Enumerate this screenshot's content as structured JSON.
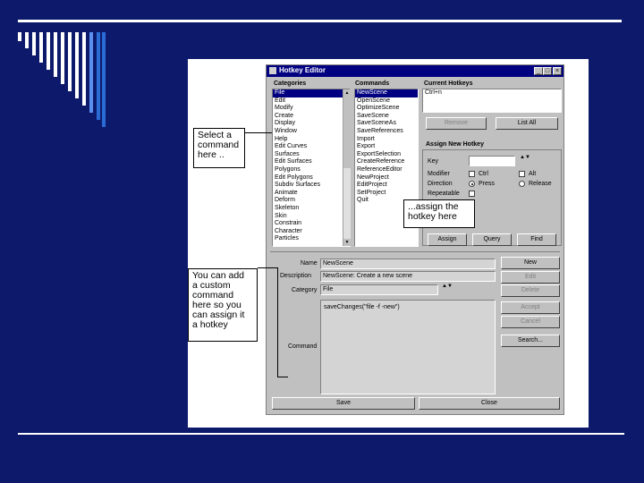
{
  "window": {
    "title": "Hotkey Editor",
    "controls": [
      "_",
      "□",
      "×"
    ]
  },
  "categories": {
    "header": "Categories",
    "items": [
      "File",
      "Edit",
      "Modify",
      "Create",
      "Display",
      "Window",
      "Help",
      "Edit Curves",
      "Surfaces",
      "Edit Surfaces",
      "Polygons",
      "Edit Polygons",
      "Subdiv Surfaces",
      "Animate",
      "Deform",
      "Skeleton",
      "Skin",
      "Constrain",
      "Character",
      "Particles"
    ]
  },
  "commands": {
    "header": "Commands",
    "items": [
      "NewScene",
      "OpenScene",
      "OptimizeScene",
      "SaveScene",
      "SaveSceneAs",
      "SaveReferences",
      "Import",
      "Export",
      "ExportSelection",
      "CreateReference",
      "ReferenceEditor",
      "NewProject",
      "EditProject",
      "SetProject",
      "Quit"
    ]
  },
  "current_hotkeys": {
    "header": "Current Hotkeys",
    "items": [
      "Ctrl+n"
    ],
    "remove_label": "Remove",
    "list_all_label": "List All"
  },
  "assign": {
    "header": "Assign New Hotkey",
    "key_label": "Key",
    "modifier_label": "Modifier",
    "ctrl_label": "Ctrl",
    "alt_label": "Alt",
    "direction_label": "Direction",
    "press_label": "Press",
    "release_label": "Release",
    "repeatable_label": "Repeatable",
    "assign_label": "Assign",
    "query_label": "Query",
    "find_label": "Find"
  },
  "editor": {
    "name_label": "Name",
    "name_value": "NewScene",
    "description_label": "Description",
    "description_value": "NewScene: Create a new scene",
    "category_label": "Category",
    "category_value": "File",
    "command_label": "Command",
    "command_value": "saveChanges(\"file -f -new\")",
    "new_label": "New",
    "edit_label": "Edit",
    "delete_label": "Delete",
    "accept_label": "Accept",
    "cancel_label": "Cancel",
    "search_label": "Search..."
  },
  "footer": {
    "save_label": "Save",
    "close_label": "Close"
  },
  "callouts": {
    "select": "Select a\ncommand\nhere ..",
    "assign": "...assign the\nhotkey here",
    "custom": "You can add\na custom\ncommand\nhere so you\ncan assign it\na hotkey"
  },
  "colors": {
    "background": "#0d1a6b",
    "titlebar": "#000080",
    "dialog": "#c0c0c0",
    "accent_stripe": "#2a6cd6"
  }
}
